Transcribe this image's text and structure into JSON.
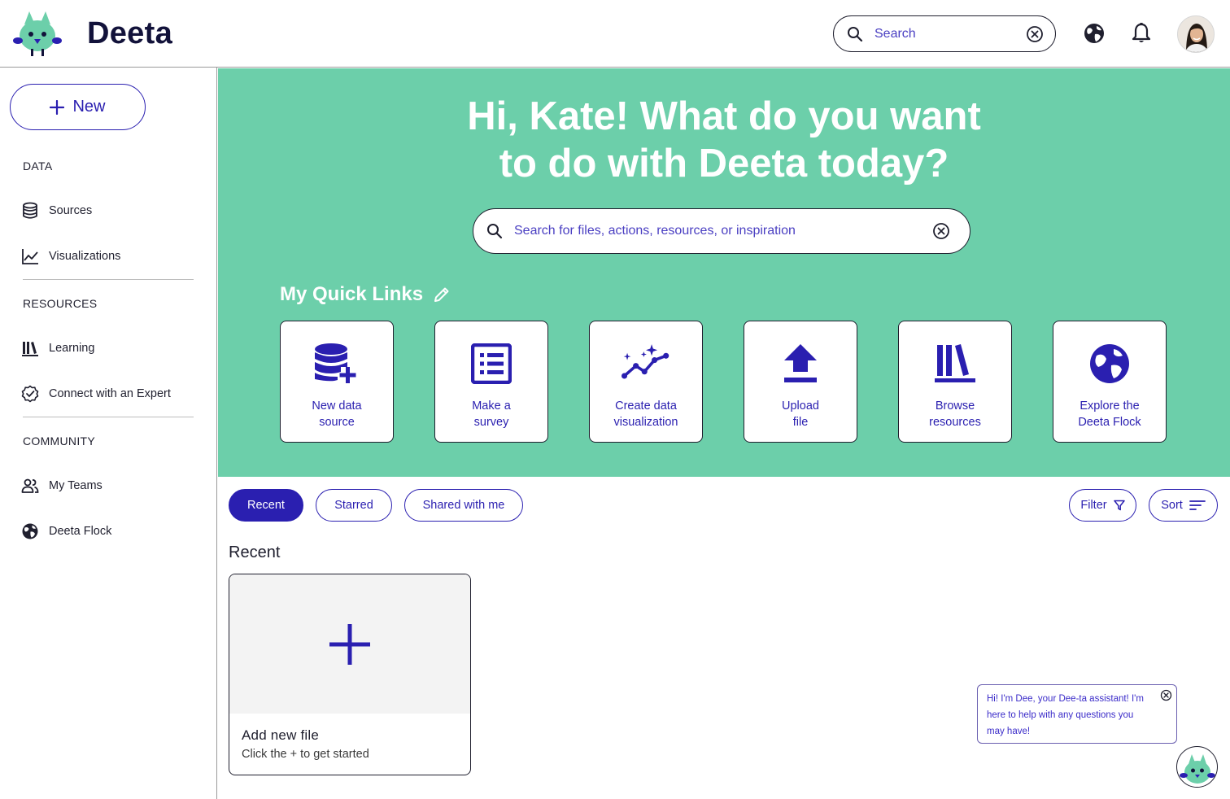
{
  "app": {
    "name": "Deeta"
  },
  "topbar": {
    "search_placeholder": "Search"
  },
  "sidebar": {
    "new_label": "New",
    "sections": {
      "data": "DATA",
      "resources": "RESOURCES",
      "community": "COMMUNITY"
    },
    "items": {
      "sources": "Sources",
      "visualizations": "Visualizations",
      "learning": "Learning",
      "connect_expert": "Connect with an Expert",
      "my_teams": "My Teams",
      "deeta_flock": "Deeta Flock"
    }
  },
  "hero": {
    "title_line1": "Hi, Kate! What do you want",
    "title_line2": "to do with Deeta today?",
    "search_placeholder": "Search for files, actions, resources, or inspiration",
    "quick_links_title": "My Quick Links",
    "quick_links": [
      {
        "line1": "New data",
        "line2": "source",
        "icon": "database-plus-icon"
      },
      {
        "line1": "Make a",
        "line2": "survey",
        "icon": "list-form-icon"
      },
      {
        "line1": "Create data",
        "line2": "visualization",
        "icon": "sparkle-chart-icon"
      },
      {
        "line1": "Upload",
        "line2": "file",
        "icon": "upload-icon"
      },
      {
        "line1": "Browse",
        "line2": "resources",
        "icon": "library-icon"
      },
      {
        "line1": "Explore the",
        "line2": "Deeta Flock",
        "icon": "globe-icon"
      }
    ]
  },
  "filters": {
    "tabs": [
      "Recent",
      "Starred",
      "Shared with me"
    ],
    "active": "Recent",
    "filter_label": "Filter",
    "sort_label": "Sort"
  },
  "recent": {
    "title": "Recent",
    "add_card_title": "Add new file",
    "add_card_subtitle": "Click the + to get started"
  },
  "assistant": {
    "message": "Hi! I'm Dee, your Dee-ta assistant! I'm here to help with any questions you may have!"
  },
  "colors": {
    "accent": "#2a1fb0",
    "hero_bg": "#6ccfaa",
    "text_dark": "#1f1f2e"
  }
}
